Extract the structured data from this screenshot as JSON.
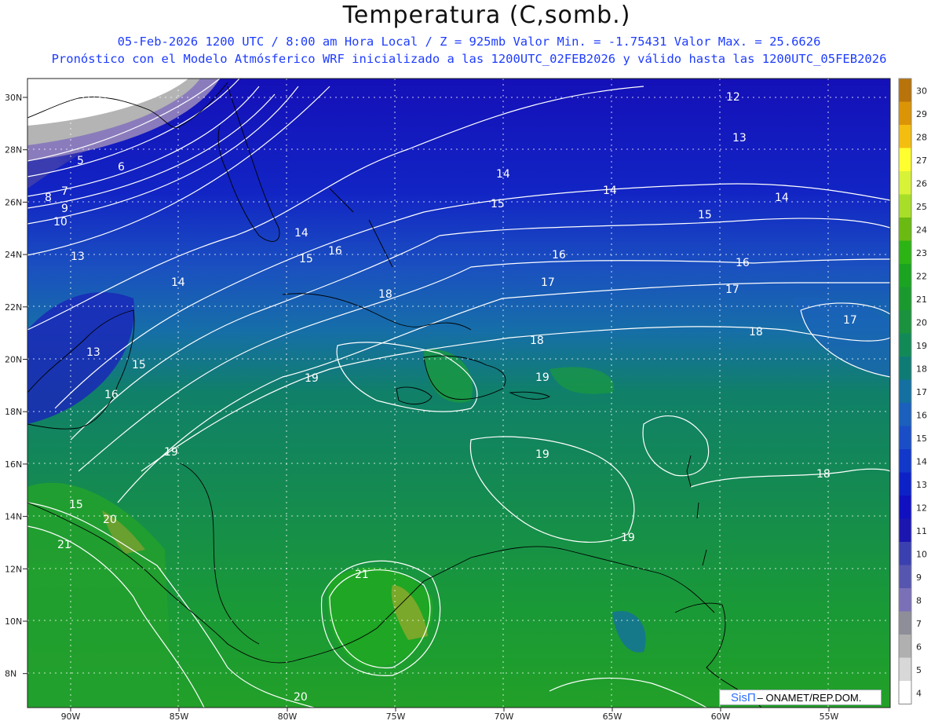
{
  "header": {
    "title": "Temperatura (C,somb.)",
    "line1": "05-Feb-2026  1200 UTC / 8:00 am Hora Local / Z = 925mb   Valor Min. = -1.75431  Valor Max. = 25.6626",
    "line2": "Pronóstico con el Modelo Atmósferico WRF inicializado a las 1200UTC_02FEB2026 y válido hasta las  1200UTC_05FEB2026"
  },
  "map": {
    "lat_labels": [
      "30N",
      "28N",
      "26N",
      "24N",
      "22N",
      "20N",
      "18N",
      "16N",
      "14N",
      "12N",
      "10N",
      "8N"
    ],
    "lon_labels": [
      "90W",
      "85W",
      "80W",
      "75W",
      "70W",
      "65W",
      "60W",
      "55W"
    ],
    "contour_labels": [
      {
        "text": "5"
      },
      {
        "text": "6"
      },
      {
        "text": "8"
      },
      {
        "text": "7"
      },
      {
        "text": "9"
      },
      {
        "text": "10"
      },
      {
        "text": "13"
      },
      {
        "text": "14"
      },
      {
        "text": "13"
      },
      {
        "text": "15"
      },
      {
        "text": "16"
      },
      {
        "text": "14"
      },
      {
        "text": "15"
      },
      {
        "text": "16"
      },
      {
        "text": "18"
      },
      {
        "text": "19"
      },
      {
        "text": "19"
      },
      {
        "text": "15"
      },
      {
        "text": "20"
      },
      {
        "text": "21"
      },
      {
        "text": "21"
      },
      {
        "text": "20"
      },
      {
        "text": "14"
      },
      {
        "text": "15"
      },
      {
        "text": "16"
      },
      {
        "text": "17"
      },
      {
        "text": "18"
      },
      {
        "text": "19"
      },
      {
        "text": "19"
      },
      {
        "text": "19"
      },
      {
        "text": "12"
      },
      {
        "text": "13"
      },
      {
        "text": "14"
      },
      {
        "text": "15"
      },
      {
        "text": "14"
      },
      {
        "text": "16"
      },
      {
        "text": "17"
      },
      {
        "text": "18"
      },
      {
        "text": "17"
      },
      {
        "text": "18"
      }
    ]
  },
  "colorbar": {
    "labels": [
      "30",
      "29",
      "28",
      "27",
      "26",
      "25",
      "24",
      "23",
      "22",
      "21",
      "20",
      "19",
      "18",
      "17",
      "16",
      "15",
      "14",
      "13",
      "12",
      "11",
      "10",
      "9",
      "8",
      "7",
      "6",
      "5",
      "4"
    ],
    "colors": [
      "#b8730a",
      "#dc9407",
      "#f4be10",
      "#ffff30",
      "#d8f238",
      "#a8de28",
      "#6aba12",
      "#2cb414",
      "#1aa422",
      "#1a9a2e",
      "#1a923e",
      "#128a58",
      "#0e7c74",
      "#1470a0",
      "#1a60bc",
      "#1a4ec6",
      "#1238ca",
      "#0d22c6",
      "#1010c0",
      "#1b16b0",
      "#3a40b0",
      "#5656b0",
      "#7a70b8",
      "#8e8e98",
      "#b0b0b0",
      "#d8d8d8",
      "#ffffff"
    ]
  },
  "credit": {
    "logo": "SisΠ",
    "text": "– ONAMET/REP.DOM."
  }
}
